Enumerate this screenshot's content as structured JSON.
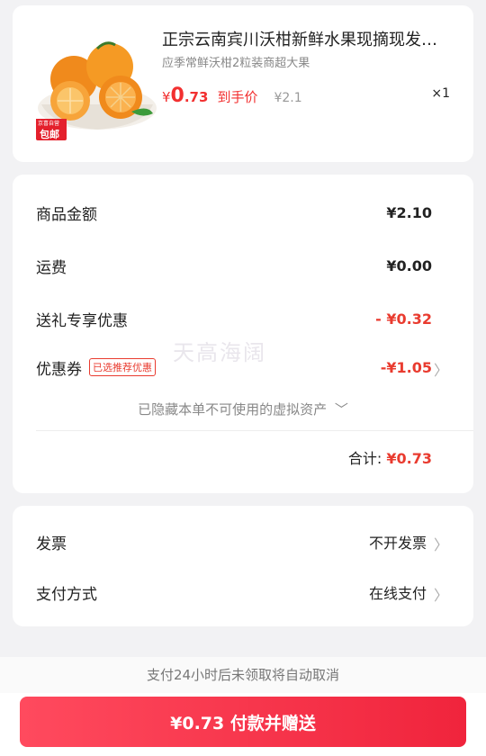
{
  "product": {
    "title": "正宗云南宾川沃柑新鲜水果现摘现发…",
    "spec": "应季常鲜沃柑2粒装商超大果",
    "price_symbol": "¥",
    "price_int": "0",
    "price_dec": ".73",
    "price_tag": "到手价",
    "orig_price": "¥2.1",
    "qty": "×1",
    "image_badge_top": "京喜自营",
    "image_badge_bottom": "包邮"
  },
  "amounts": {
    "goods_label": "商品金额",
    "goods_value": "¥2.10",
    "shipping_label": "运费",
    "shipping_value": "¥0.00",
    "gift_label": "送礼专享优惠",
    "gift_value": "- ¥0.32",
    "coupon_label": "优惠券",
    "coupon_badge": "已选推荐优惠",
    "coupon_value": "-¥1.05",
    "hidden_note": "已隐藏本单不可使用的虚拟资产",
    "total_label": "合计:",
    "total_value": "¥0.73",
    "watermark": "天高海阔"
  },
  "settings": {
    "invoice_label": "发票",
    "invoice_value": "不开发票",
    "payment_label": "支付方式",
    "payment_value": "在线支付"
  },
  "footer": {
    "notice": "支付24小时后未领取将自动取消",
    "pay_button": "¥0.73 付款并赠送"
  },
  "colors": {
    "accent": "#f23030",
    "button_start": "#ff4a5e",
    "button_end": "#f0243c"
  }
}
